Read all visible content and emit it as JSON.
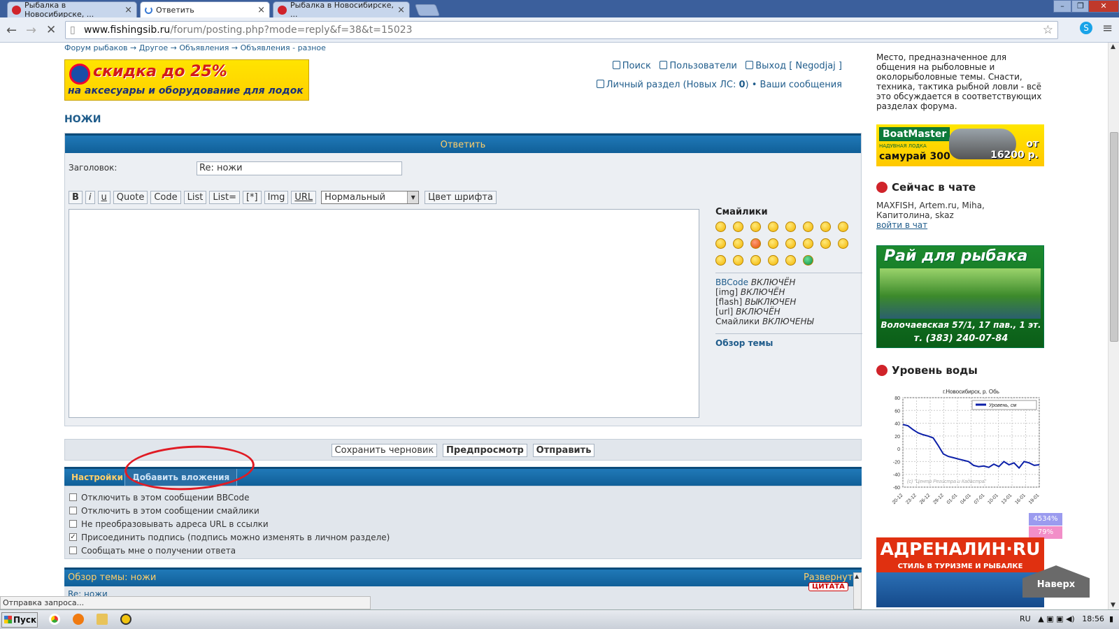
{
  "browser": {
    "tabs": [
      {
        "title": "Рыбалка в Новосибирске, ...",
        "active": false
      },
      {
        "title": "Ответить",
        "active": true
      },
      {
        "title": "Рыбалка в Новосибирске, ...",
        "active": false
      }
    ],
    "url_host": "www.fishingsib.ru",
    "url_path": "/forum/posting.php?mode=reply&f=38&t=15023",
    "status_text": "Отправка запроса..."
  },
  "forum": {
    "breadcrumb": "Форум рыбаков → Другое → Объявления → Объявления - разное",
    "banner": {
      "line1": "скидка до 25%",
      "line2": "на аксесуары и оборудование для лодок"
    },
    "toplinks": {
      "search": "Поиск",
      "users": "Пользователи",
      "logout": "Выход [ Negodjaj ]",
      "personal_prefix": "Личный раздел (Новых ЛС: ",
      "personal_count": "0",
      "personal_suffix": ")",
      "bullet": "•",
      "my_posts": "Ваши сообщения"
    },
    "topic_title": "НОЖИ",
    "reply_panel": {
      "heading": "Ответить",
      "subject_label": "Заголовок:",
      "subject_value": "Re: ножи",
      "bbcode_buttons": [
        "B",
        "i",
        "u",
        "Quote",
        "Code",
        "List",
        "List=",
        "[*]",
        "Img",
        "URL"
      ],
      "font_size_selected": "Нормальный",
      "font_color_button": "Цвет шрифта",
      "smileys_title": "Смайлики",
      "bbcode_status": [
        {
          "label": "BBCode",
          "state": "ВКЛЮЧЁН"
        },
        {
          "label": "[img]",
          "state": "ВКЛЮЧЁН"
        },
        {
          "label": "[flash]",
          "state": "ВЫКЛЮЧЕН"
        },
        {
          "label": "[url]",
          "state": "ВКЛЮЧЁН"
        },
        {
          "label": "Смайлики",
          "state": "ВКЛЮЧЕНЫ"
        }
      ],
      "review_link": "Обзор темы"
    },
    "actions": {
      "save_draft": "Сохранить черновик",
      "preview": "Предпросмотр",
      "submit": "Отправить"
    },
    "option_tabs": {
      "settings": "Настройки",
      "attachments": "Добавить вложения"
    },
    "options": [
      {
        "label": "Отключить в этом сообщении BBCode",
        "checked": false
      },
      {
        "label": "Отключить в этом сообщении смайлики",
        "checked": false
      },
      {
        "label": "Не преобразовывать адреса URL в ссылки",
        "checked": false
      },
      {
        "label": "Присоединить подпись (подпись можно изменять в личном разделе)",
        "checked": true
      },
      {
        "label": "Сообщать мне о получении ответа",
        "checked": false
      }
    ],
    "topic_review": {
      "heading": "Обзор темы: ножи",
      "expand": "Развернуть",
      "quote": "ЦИТАТА",
      "first_line": "Re: ножи"
    }
  },
  "sidebar": {
    "description": "Место, предназначенное для общения на рыболовные и околорыболовные темы. Снасти, техника, тактика рыбной ловли - всё это обсуждается в соответствующих разделах форума.",
    "boatmaster": {
      "logo": "BoatMaster",
      "sub": "НАДУВНАЯ ЛОДКА",
      "model": "самурай 300",
      "price_from": "от",
      "price": "16200 р."
    },
    "chat": {
      "heading": "Сейчас в чате",
      "users": "MAXFISH, Artem.ru, Miha, Капитолина, skaz",
      "join": "войти в чат"
    },
    "rai": {
      "title": "Рай для рыбака",
      "address1": "Волочаевская 57/1, 17 пав., 1 эт.",
      "address2": "т. (383) 240-07-84"
    },
    "water": {
      "heading": "Уровень воды"
    },
    "percent_top": "4534%",
    "percent_bottom": "79%",
    "adrenalin": {
      "title": "АДРЕНАЛИН·RU",
      "sub": "СТИЛЬ В ТУРИЗМЕ И РЫБАЛКЕ"
    },
    "back_to_top": "Наверх"
  },
  "chart_data": {
    "type": "line",
    "title": "г.Новосибирск, р. Обь",
    "series": [
      {
        "name": "Уровень, см",
        "values": [
          38,
          36,
          30,
          25,
          22,
          20,
          17,
          5,
          -8,
          -12,
          -14,
          -16,
          -18,
          -20,
          -26,
          -28,
          -27,
          -29,
          -24,
          -28,
          -20,
          -25,
          -22,
          -30,
          -20,
          -22,
          -26,
          -25
        ]
      }
    ],
    "x_tick_labels": [
      "20-12",
      "23-12",
      "26-12",
      "29-12",
      "01-01",
      "04-01",
      "07-01",
      "10-01",
      "13-01",
      "16-01",
      "19-01"
    ],
    "y_ticks": [
      80,
      60,
      40,
      20,
      0,
      -20,
      -40,
      -60
    ],
    "ylim": [
      -60,
      80
    ],
    "annotation": "(c) \"Центр Регистра и Кадастра\"",
    "grid": true,
    "legend_position": "top-right",
    "line_color": "#0b1fa8"
  },
  "taskbar": {
    "start": "Пуск",
    "lang": "RU",
    "time": "18:56"
  }
}
